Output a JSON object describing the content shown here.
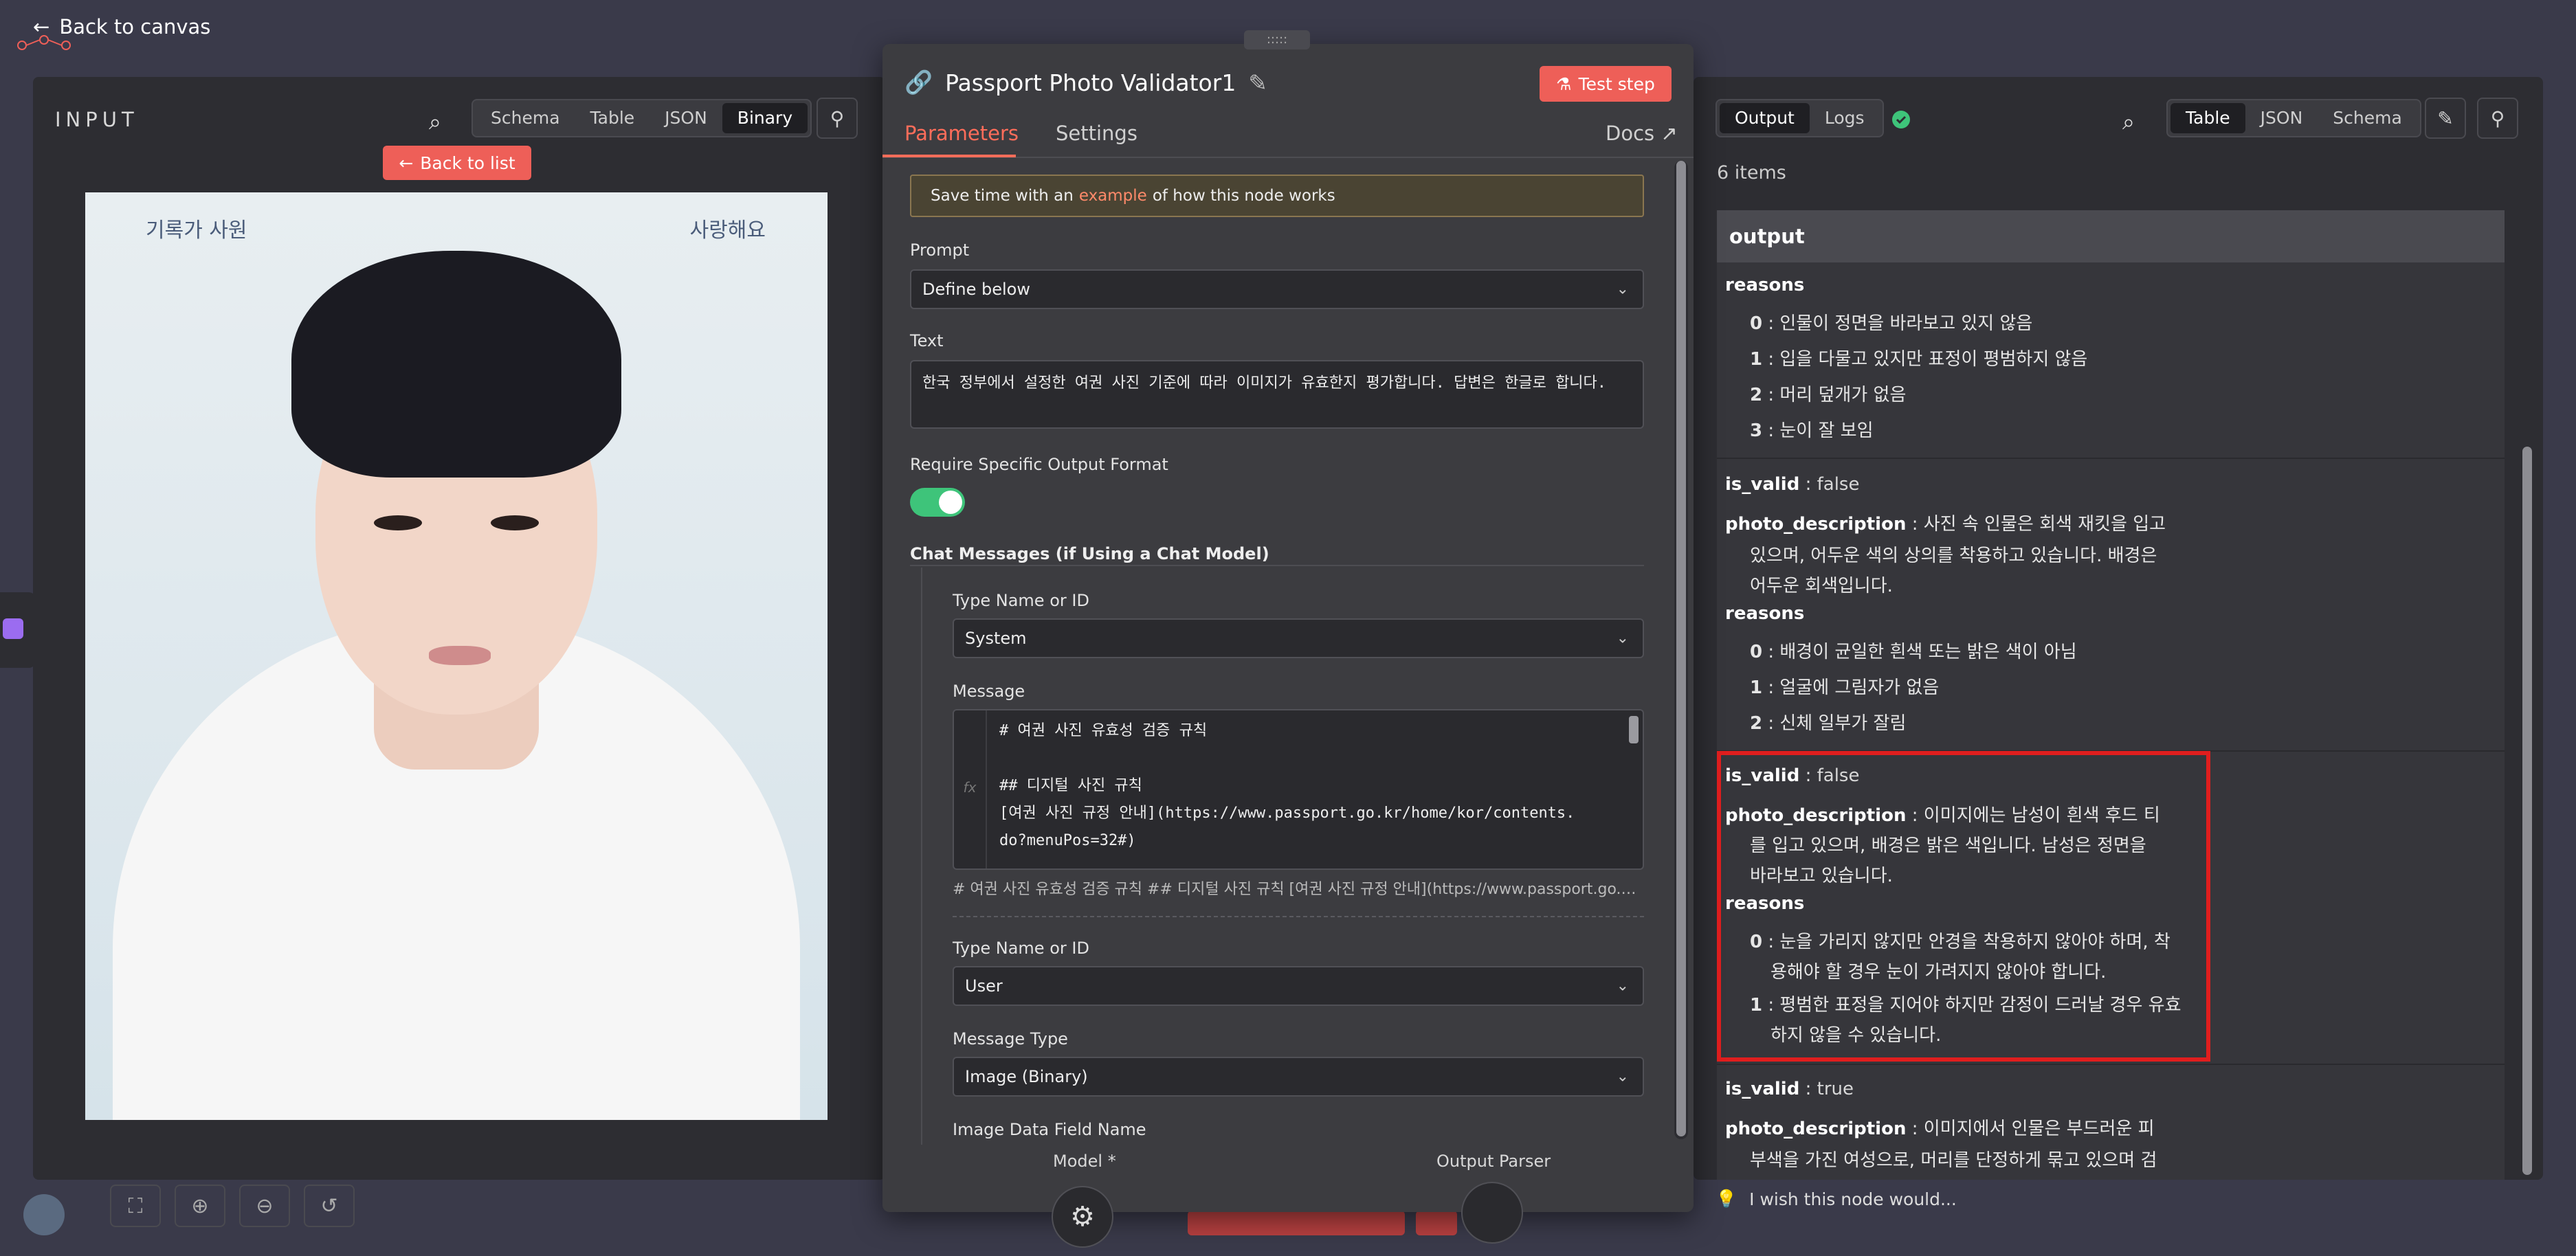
{
  "topbar": {
    "back_label": "Back to canvas"
  },
  "input": {
    "title": "INPUT",
    "views": [
      "Schema",
      "Table",
      "JSON",
      "Binary"
    ],
    "active_view": "Binary",
    "back_to_list": "Back to list",
    "photo": {
      "sig_left": "기록가 사원",
      "sig_right": "사랑해요"
    }
  },
  "node": {
    "title": "Passport Photo Validator1",
    "test_step": "Test step",
    "tabs": [
      "Parameters",
      "Settings"
    ],
    "docs": "Docs",
    "banner": {
      "prefix": "Save time with an",
      "link": "example",
      "suffix": "of how this node works"
    },
    "prompt_label": "Prompt",
    "prompt_value": "Define below",
    "text_label": "Text",
    "text_value": "한국 정부에서 설정한 여권 사진 기준에 따라 이미지가 유효한지 평가합니다. 답변은 한글로 합니다.",
    "require_label": "Require Specific Output Format",
    "chat_label": "Chat Messages (if Using a Chat Model)",
    "type1_label": "Type Name or ID",
    "type1_value": "System",
    "message_label": "Message",
    "message_lines": "# 여권 사진 유효성 검증 규칙\n\n## 디지털 사진 규칙\n[여권 사진 규정 안내](https://www.passport.go.kr/home/kor/contents.\ndo?menuPos=32#)",
    "message_preview": "# 여권 사진 유효성 검증 규칙 ## 디지털 사진 규칙 [여권 사진 규정 안내](https://www.passport.go.k...",
    "type2_label": "Type Name or ID",
    "type2_value": "User",
    "msg_type_label": "Message Type",
    "msg_type_value": "Image (Binary)",
    "image_field_label": "Image Data Field Name",
    "model_label": "Model *",
    "parser_label": "Output Parser"
  },
  "output": {
    "tabs": [
      "Output",
      "Logs"
    ],
    "views": [
      "Table",
      "JSON",
      "Schema"
    ],
    "active_view": "Table",
    "count": "6 items",
    "header": "output",
    "item1": {
      "reasons_key": "reasons",
      "r0": "인물이 정면을 바라보고 있지 않음",
      "r1": "입을 다물고 있지만 표정이 평범하지 않음",
      "r2": "머리 덮개가 없음",
      "r3": "눈이 잘 보임"
    },
    "item2": {
      "valid_key": "is_valid",
      "valid_val": "false",
      "desc_key": "photo_description",
      "desc_l1": "사진 속 인물은 회색 재킷을 입고",
      "desc_l2": "있으며, 어두운 색의 상의를 착용하고 있습니다. 배경은",
      "desc_l3": "어두운 회색입니다.",
      "reasons_key": "reasons",
      "r0": "배경이 균일한 흰색 또는 밝은 색이 아님",
      "r1": "얼굴에 그림자가 없음",
      "r2": "신체 일부가 잘림"
    },
    "item3": {
      "valid_key": "is_valid",
      "valid_val": "false",
      "desc_key": "photo_description",
      "desc_l1": "이미지에는 남성이 흰색 후드 티",
      "desc_l2": "를 입고 있으며, 배경은 밝은 색입니다. 남성은 정면을",
      "desc_l3": "바라보고 있습니다.",
      "reasons_key": "reasons",
      "r0_l1": "눈을 가리지 않지만 안경을 착용하지 않아야 하며, 착",
      "r0_l2": "용해야 할 경우 눈이 가려지지 않아야 합니다.",
      "r1_l1": "평범한 표정을 지어야 하지만 감정이 드러날 경우 유효",
      "r1_l2": "하지 않을 수 있습니다."
    },
    "item4": {
      "valid_key": "is_valid",
      "valid_val": "true",
      "desc_key": "photo_description",
      "desc_l1": "이미지에서 인물은 부드러운 피",
      "desc_l2": "부색을 가진 여성으로, 머리를 단정하게 묶고 있으며 검"
    },
    "idx": [
      "0",
      "1",
      "2",
      "3"
    ]
  },
  "footer": {
    "wish": "I wish this node would..."
  },
  "colors": {
    "accent": "#ff6d5a",
    "success": "#3ec47a",
    "highlight": "#e01e1e"
  }
}
